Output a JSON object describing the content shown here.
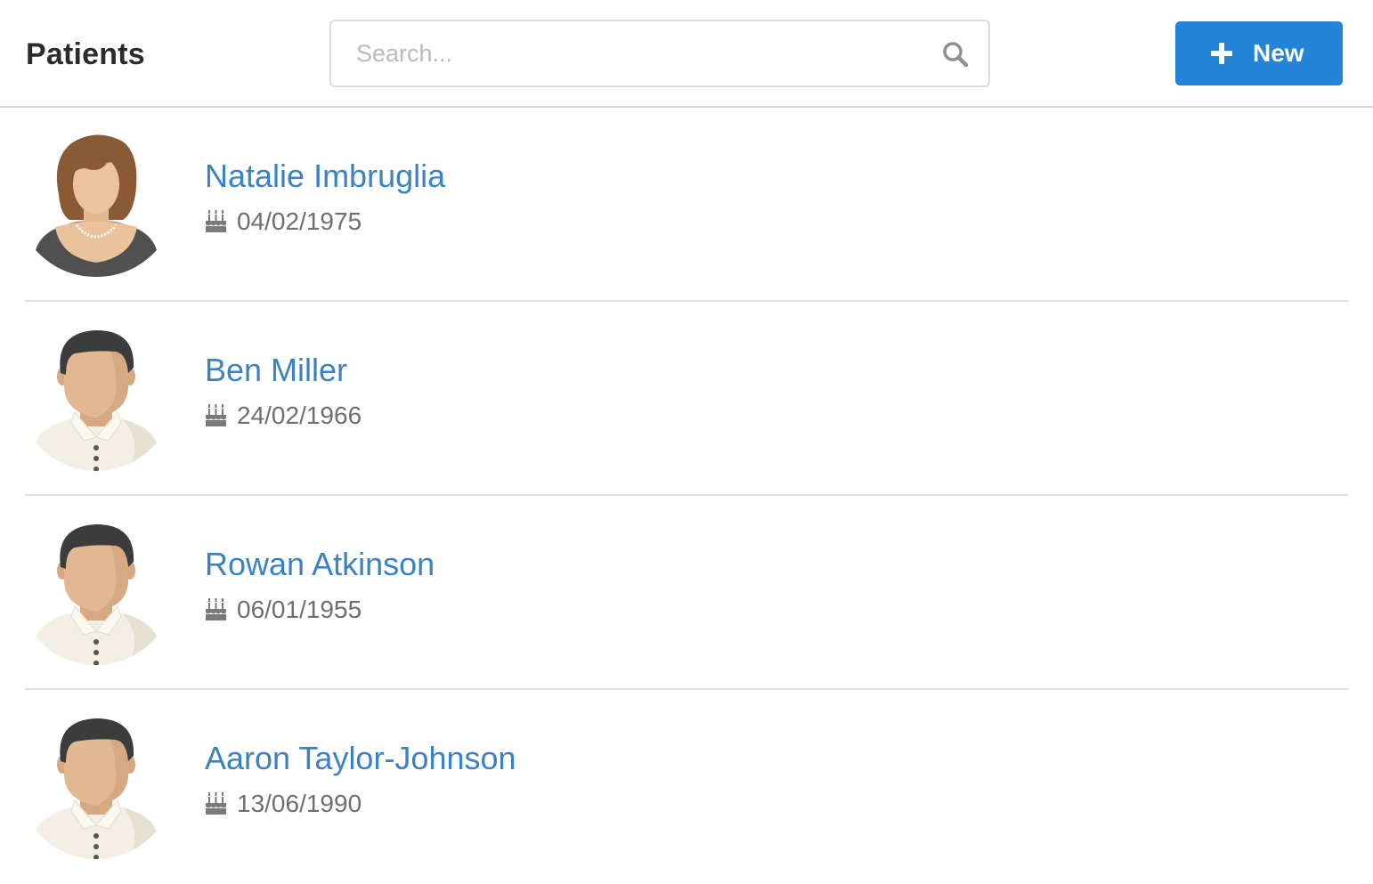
{
  "header": {
    "title": "Patients",
    "search": {
      "placeholder": "Search...",
      "value": "",
      "icon": "search-icon"
    },
    "new_button": {
      "label": "New",
      "icon": "plus-icon",
      "color": "#2384d8"
    }
  },
  "patients": [
    {
      "name": "Natalie Imbruglia",
      "dob": "04/02/1975",
      "avatar": "female-avatar"
    },
    {
      "name": "Ben Miller",
      "dob": "24/02/1966",
      "avatar": "male-avatar"
    },
    {
      "name": "Rowan Atkinson",
      "dob": "06/01/1955",
      "avatar": "male-avatar"
    },
    {
      "name": "Aaron Taylor-Johnson",
      "dob": "13/06/1990",
      "avatar": "male-avatar"
    }
  ],
  "colors": {
    "name_link": "#3a82c4",
    "dob_text": "#6e6e6e",
    "divider": "#e0e0e0"
  }
}
